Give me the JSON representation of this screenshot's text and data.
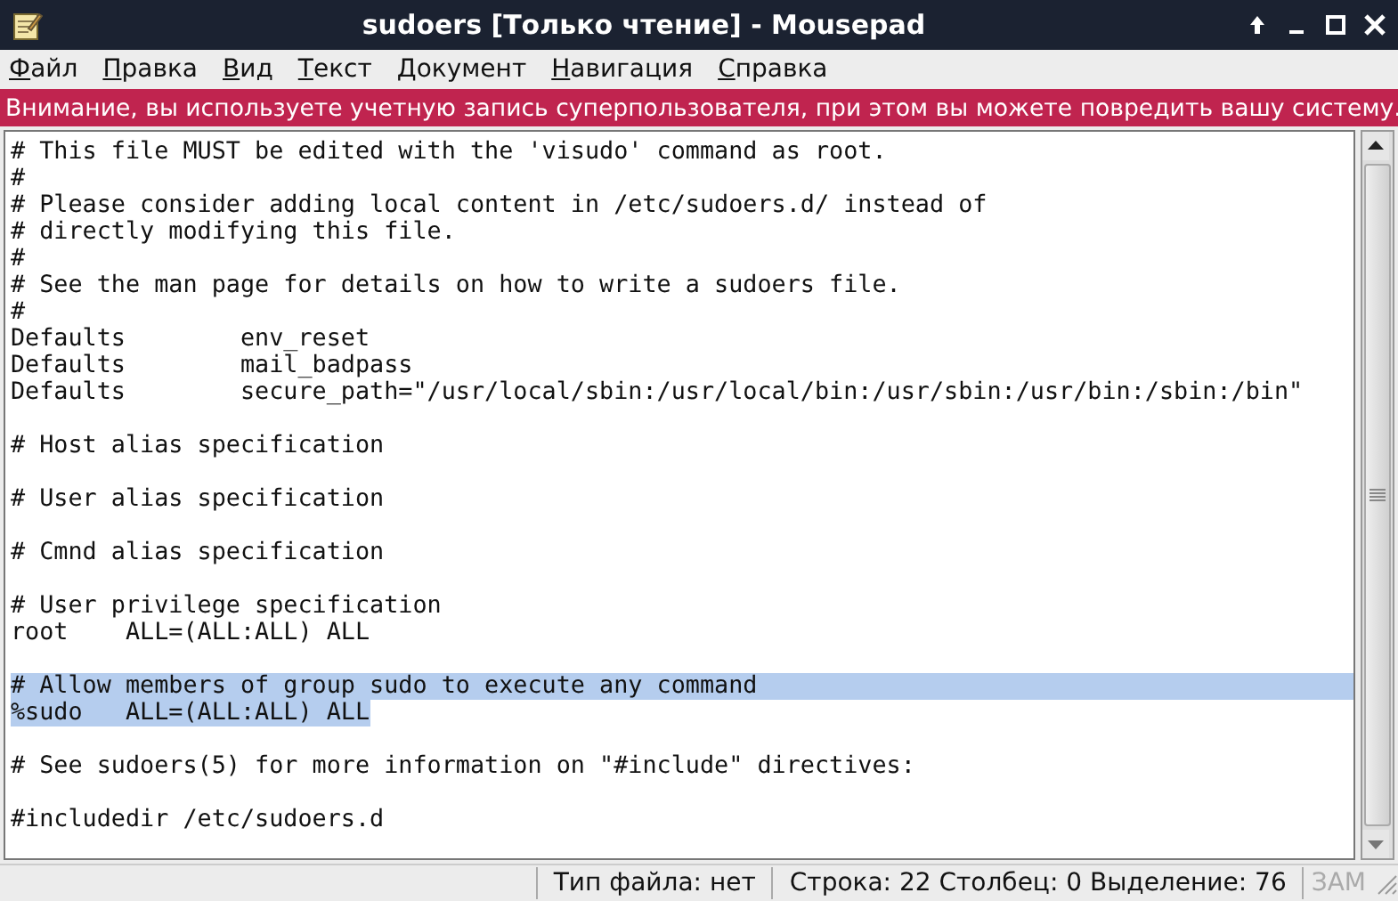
{
  "window": {
    "title": "sudoers [Только чтение] - Mousepad"
  },
  "menu": [
    "Файл",
    "Правка",
    "Вид",
    "Текст",
    "Документ",
    "Навигация",
    "Справка"
  ],
  "warning": "Внимание, вы используете учетную запись суперпользователя, при этом вы можете повредить вашу систему.",
  "editor": {
    "lines": [
      {
        "text": "# This file MUST be edited with the 'visudo' command as root.",
        "selected": false
      },
      {
        "text": "#",
        "selected": false
      },
      {
        "text": "# Please consider adding local content in /etc/sudoers.d/ instead of",
        "selected": false
      },
      {
        "text": "# directly modifying this file.",
        "selected": false
      },
      {
        "text": "#",
        "selected": false
      },
      {
        "text": "# See the man page for details on how to write a sudoers file.",
        "selected": false
      },
      {
        "text": "#",
        "selected": false
      },
      {
        "text": "Defaults        env_reset",
        "selected": false
      },
      {
        "text": "Defaults        mail_badpass",
        "selected": false
      },
      {
        "text": "Defaults        secure_path=\"/usr/local/sbin:/usr/local/bin:/usr/sbin:/usr/bin:/sbin:/bin\"",
        "selected": false
      },
      {
        "selected": false
      },
      {
        "text": "# Host alias specification",
        "selected": false
      },
      {
        "selected": false
      },
      {
        "text": "# User alias specification",
        "selected": false
      },
      {
        "selected": false
      },
      {
        "text": "# Cmnd alias specification",
        "selected": false
      },
      {
        "selected": false
      },
      {
        "text": "# User privilege specification",
        "selected": false
      },
      {
        "text": "root    ALL=(ALL:ALL) ALL",
        "selected": false
      },
      {
        "selected": false
      },
      {
        "text": "# Allow members of group sudo to execute any command",
        "selected": true
      },
      {
        "text": "%sudo   ALL=(ALL:ALL) ALL",
        "selected": true
      },
      {
        "selected": false
      },
      {
        "text": "# See sudoers(5) for more information on \"#include\" directives:",
        "selected": false
      },
      {
        "selected": false
      },
      {
        "text": "#includedir /etc/sudoers.d",
        "selected": false
      }
    ]
  },
  "status_bar": {
    "file_type": "Тип файла: нет",
    "position": "Строка: 22 Столбец: 0 Выделение: 76",
    "overwrite": {
      "label": "ЗАМ",
      "active": false
    }
  }
}
